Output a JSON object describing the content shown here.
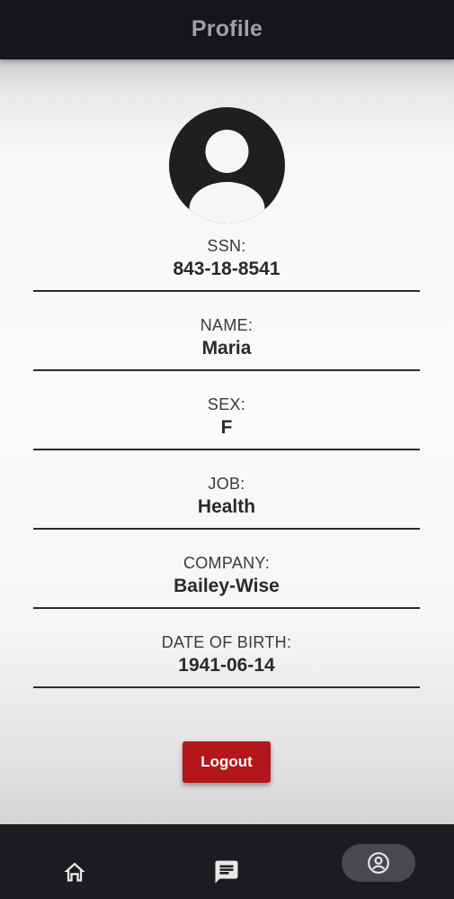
{
  "app_bar": {
    "title": "Profile"
  },
  "avatar": {
    "icon": "account-circle-icon"
  },
  "fields": [
    {
      "label": "SSN:",
      "value": "843-18-8541"
    },
    {
      "label": "NAME:",
      "value": "Maria"
    },
    {
      "label": "SEX:",
      "value": "F"
    },
    {
      "label": "JOB:",
      "value": "Health"
    },
    {
      "label": "COMPANY:",
      "value": "Bailey-Wise"
    },
    {
      "label": "DATE OF BIRTH:",
      "value": "1941-06-14"
    }
  ],
  "logout": {
    "label": "Logout",
    "color": "#b3161b"
  },
  "bottom_nav": {
    "items": [
      {
        "icon": "home-icon",
        "active": false
      },
      {
        "icon": "chat-icon",
        "active": false
      },
      {
        "icon": "profile-icon",
        "active": true
      }
    ]
  },
  "colors": {
    "app_bar": "#15161a",
    "bottom_nav": "#1b1c20",
    "active_pill": "#48494e",
    "title_text": "#9fa0a4"
  }
}
